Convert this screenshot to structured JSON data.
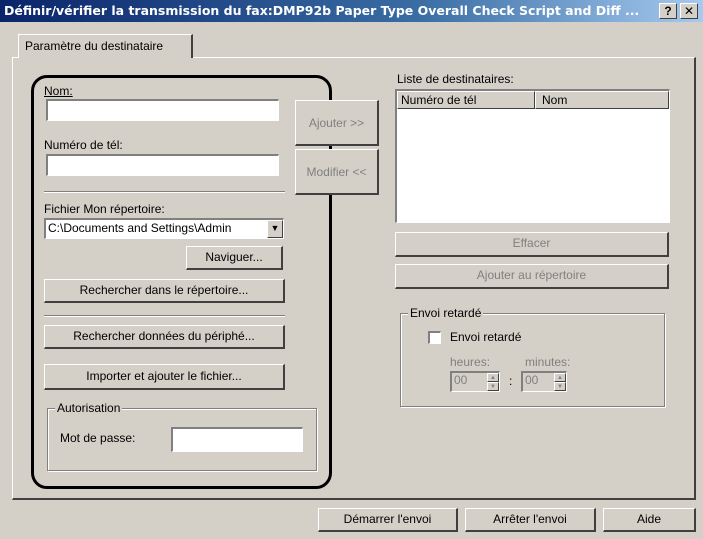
{
  "window": {
    "title": "Définir/vérifier la transmission du fax:DMP92b Paper Type Overall Check Script and Diff ...",
    "help_label": "?",
    "close_label": "✕"
  },
  "tab": {
    "label": "Paramètre du destinataire"
  },
  "left": {
    "name_label": "Nom:",
    "name_value": "",
    "phone_label": "Numéro de tél:",
    "phone_value": "",
    "directory_label": "Fichier Mon répertoire:",
    "directory_value": "C:\\Documents and Settings\\Admin",
    "browse_button": "Naviguer...",
    "search_directory_button": "Rechercher dans le répertoire...",
    "search_device_button": "Rechercher données du périphé...",
    "import_button": "Importer et ajouter le fichier...",
    "auth_group": "Autorisation",
    "password_label": "Mot de passe:",
    "password_value": ""
  },
  "middle": {
    "add_button": "Ajouter >>",
    "modify_button": "Modifier <<"
  },
  "right": {
    "recipient_list_label": "Liste de destinataires:",
    "columns": [
      "Numéro de tél",
      "Nom"
    ],
    "delete_button": "Effacer",
    "add_to_directory_button": "Ajouter au répertoire",
    "delayed_group": "Envoi retardé",
    "delayed_checkbox_label": "Envoi retardé",
    "delayed_checked": false,
    "hours_label": "heures:",
    "minutes_label": "minutes:",
    "hours_value": "00",
    "minutes_value": "00",
    "time_separator": ":"
  },
  "footer": {
    "start_button": "Démarrer l'envoi",
    "stop_button": "Arrêter l'envoi",
    "help_button": "Aide"
  },
  "colors": {
    "dialog_face": "#d4d0c8",
    "title_gradient_start": "#0a246a",
    "title_gradient_end": "#a6caf0",
    "disabled_text": "#808080"
  }
}
